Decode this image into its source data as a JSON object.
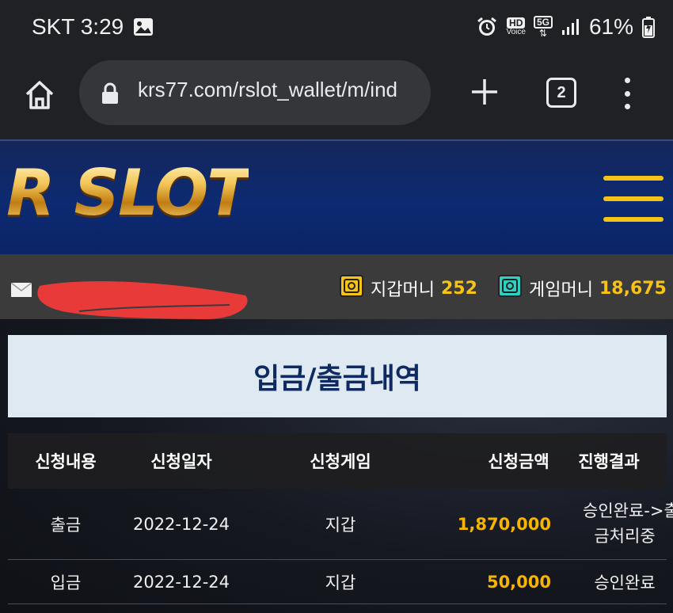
{
  "status_bar": {
    "carrier_time": "SKT 3:29",
    "battery": "61%",
    "icons": [
      "image-icon",
      "alarm-icon",
      "hd-voice-icon",
      "5g-icon",
      "signal-icon",
      "battery-icon"
    ],
    "hd_label": "HD",
    "voice_label": "Voice",
    "five_g_label": "5G"
  },
  "browser": {
    "url": "krs77.com/rslot_wallet/m/ind",
    "tab_count": "2"
  },
  "site": {
    "logo_text": "R SLOT",
    "wallet_money_label": "지갑머니",
    "wallet_money_value": "252",
    "game_money_label": "게임머니",
    "game_money_value": "18,675",
    "colors": {
      "accent": "#f7c317",
      "header_bg": "#0d2a72",
      "title_text": "#0f2a60"
    }
  },
  "main": {
    "title": "입금/출금내역",
    "columns": [
      "신청내용",
      "신청일자",
      "신청게임",
      "신청금액",
      "진행결과"
    ],
    "rows": [
      {
        "type": "출금",
        "date": "2022-12-24",
        "game": "지갑",
        "amount": "1,870,000",
        "result_line1": "승인완료->출",
        "result_line2": "금처리중"
      },
      {
        "type": "입금",
        "date": "2022-12-24",
        "game": "지갑",
        "amount": "50,000",
        "result_line1": "승인완료",
        "result_line2": ""
      }
    ]
  }
}
